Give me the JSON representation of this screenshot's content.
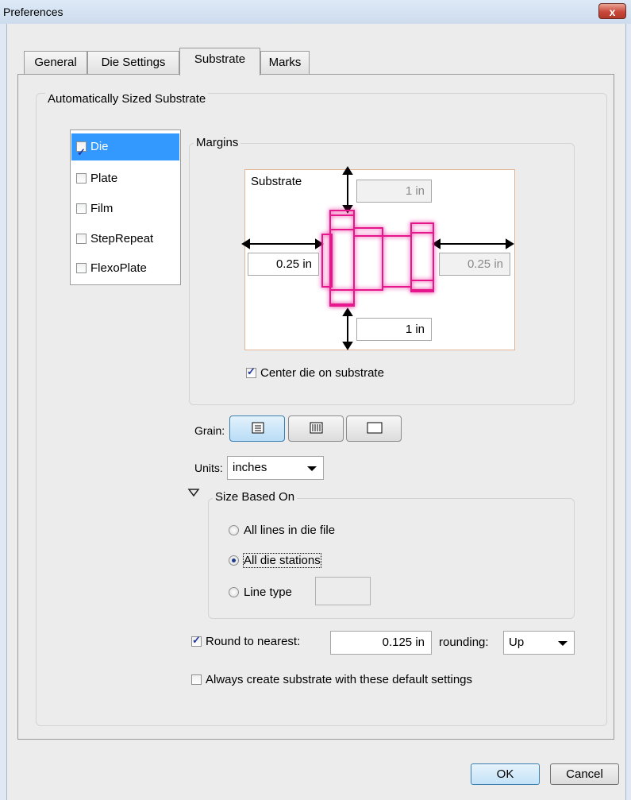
{
  "window": {
    "title": "Preferences",
    "close_glyph": "x"
  },
  "tabs": [
    "General",
    "Die Settings",
    "Substrate",
    "Marks"
  ],
  "active_tab": "Substrate",
  "auto_sized_group": {
    "label": "Automatically Sized Substrate"
  },
  "list": {
    "items": [
      {
        "label": "Die",
        "checked": true,
        "selected": true
      },
      {
        "label": "Plate",
        "checked": false,
        "selected": false
      },
      {
        "label": "Film",
        "checked": false,
        "selected": false
      },
      {
        "label": "StepRepeat",
        "checked": false,
        "selected": false
      },
      {
        "label": "FlexoPlate",
        "checked": false,
        "selected": false
      }
    ]
  },
  "margins": {
    "label": "Margins",
    "substrate_label": "Substrate",
    "top": "1 in",
    "left": "0.25 in",
    "right": "0.25 in",
    "bottom": "1 in",
    "center_label": "Center die on substrate",
    "center_checked": true
  },
  "grain": {
    "label": "Grain:",
    "selected": 0,
    "icons": [
      "grain-horizontal-icon",
      "grain-vertical-icon",
      "grain-none-icon"
    ]
  },
  "units": {
    "label": "Units:",
    "value": "inches"
  },
  "size_based_on": {
    "label": "Size Based On",
    "options": [
      "All lines in die file",
      "All die stations",
      "Line type"
    ],
    "selected": 1
  },
  "round": {
    "label": "Round to nearest:",
    "checked": true,
    "value": "0.125 in",
    "rounding_label": "rounding:",
    "rounding_value": "Up"
  },
  "always_create": {
    "label": "Always create substrate with these default settings",
    "checked": false
  },
  "buttons": {
    "ok": "OK",
    "cancel": "Cancel"
  },
  "colors": {
    "die_outline": "#e6178c",
    "selection": "#3399ff"
  }
}
